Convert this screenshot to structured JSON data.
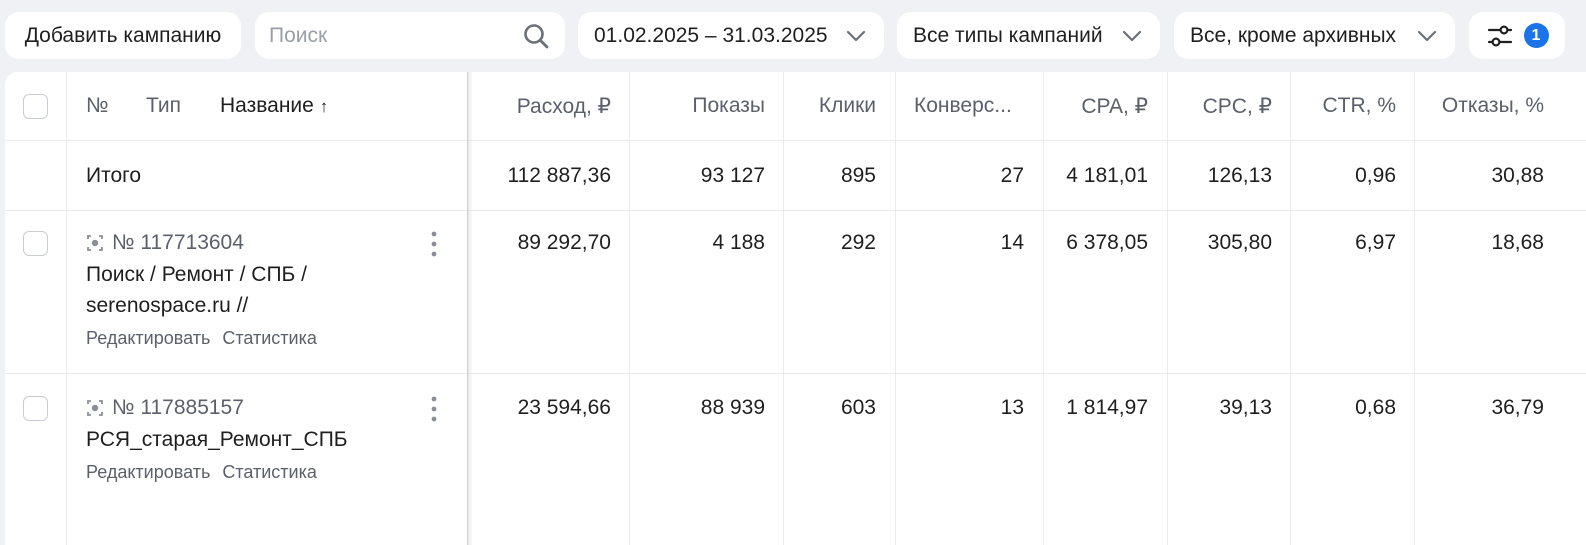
{
  "toolbar": {
    "add_campaign": "Добавить кампанию",
    "search_placeholder": "Поиск",
    "date_range": "01.02.2025 – 31.03.2025",
    "campaign_types": "Все типы кампаний",
    "status_filter": "Все, кроме архивных",
    "filters_count": "1"
  },
  "table": {
    "headers": {
      "number": "№",
      "type": "Тип",
      "name": "Название",
      "name_sort": "↑",
      "cost": "Расход, ₽",
      "impressions": "Показы",
      "clicks": "Клики",
      "conversions": "Конверс...",
      "cpa": "CPA, ₽",
      "cpc": "CPC, ₽",
      "ctr": "CTR, %",
      "bounces": "Отказы, %"
    },
    "total": {
      "label": "Итого",
      "cost": "112 887,36",
      "impressions": "93 127",
      "clicks": "895",
      "conversions": "27",
      "cpa": "4 181,01",
      "cpc": "126,13",
      "ctr": "0,96",
      "bounces": "30,88"
    },
    "rows": [
      {
        "id": "№ 117713604",
        "name_line1": "Поиск / Ремонт / СПБ /",
        "name_line2": "serenospace.ru //",
        "edit": "Редактировать",
        "stats": "Статистика",
        "cost": "89 292,70",
        "impressions": "4 188",
        "clicks": "292",
        "conversions": "14",
        "cpa": "6 378,05",
        "cpc": "305,80",
        "ctr": "6,97",
        "bounces": "18,68"
      },
      {
        "id": "№ 117885157",
        "name_line1": "РСЯ_старая_Ремонт_СПБ",
        "edit": "Редактировать",
        "stats": "Статистика",
        "cost": "23 594,66",
        "impressions": "88 939",
        "clicks": "603",
        "conversions": "13",
        "cpa": "1 814,97",
        "cpc": "39,13",
        "ctr": "0,68",
        "bounces": "36,79"
      }
    ]
  },
  "colors": {
    "background": "#eff1f5",
    "badge": "#1a73e8",
    "muted_text": "#5c606a"
  }
}
